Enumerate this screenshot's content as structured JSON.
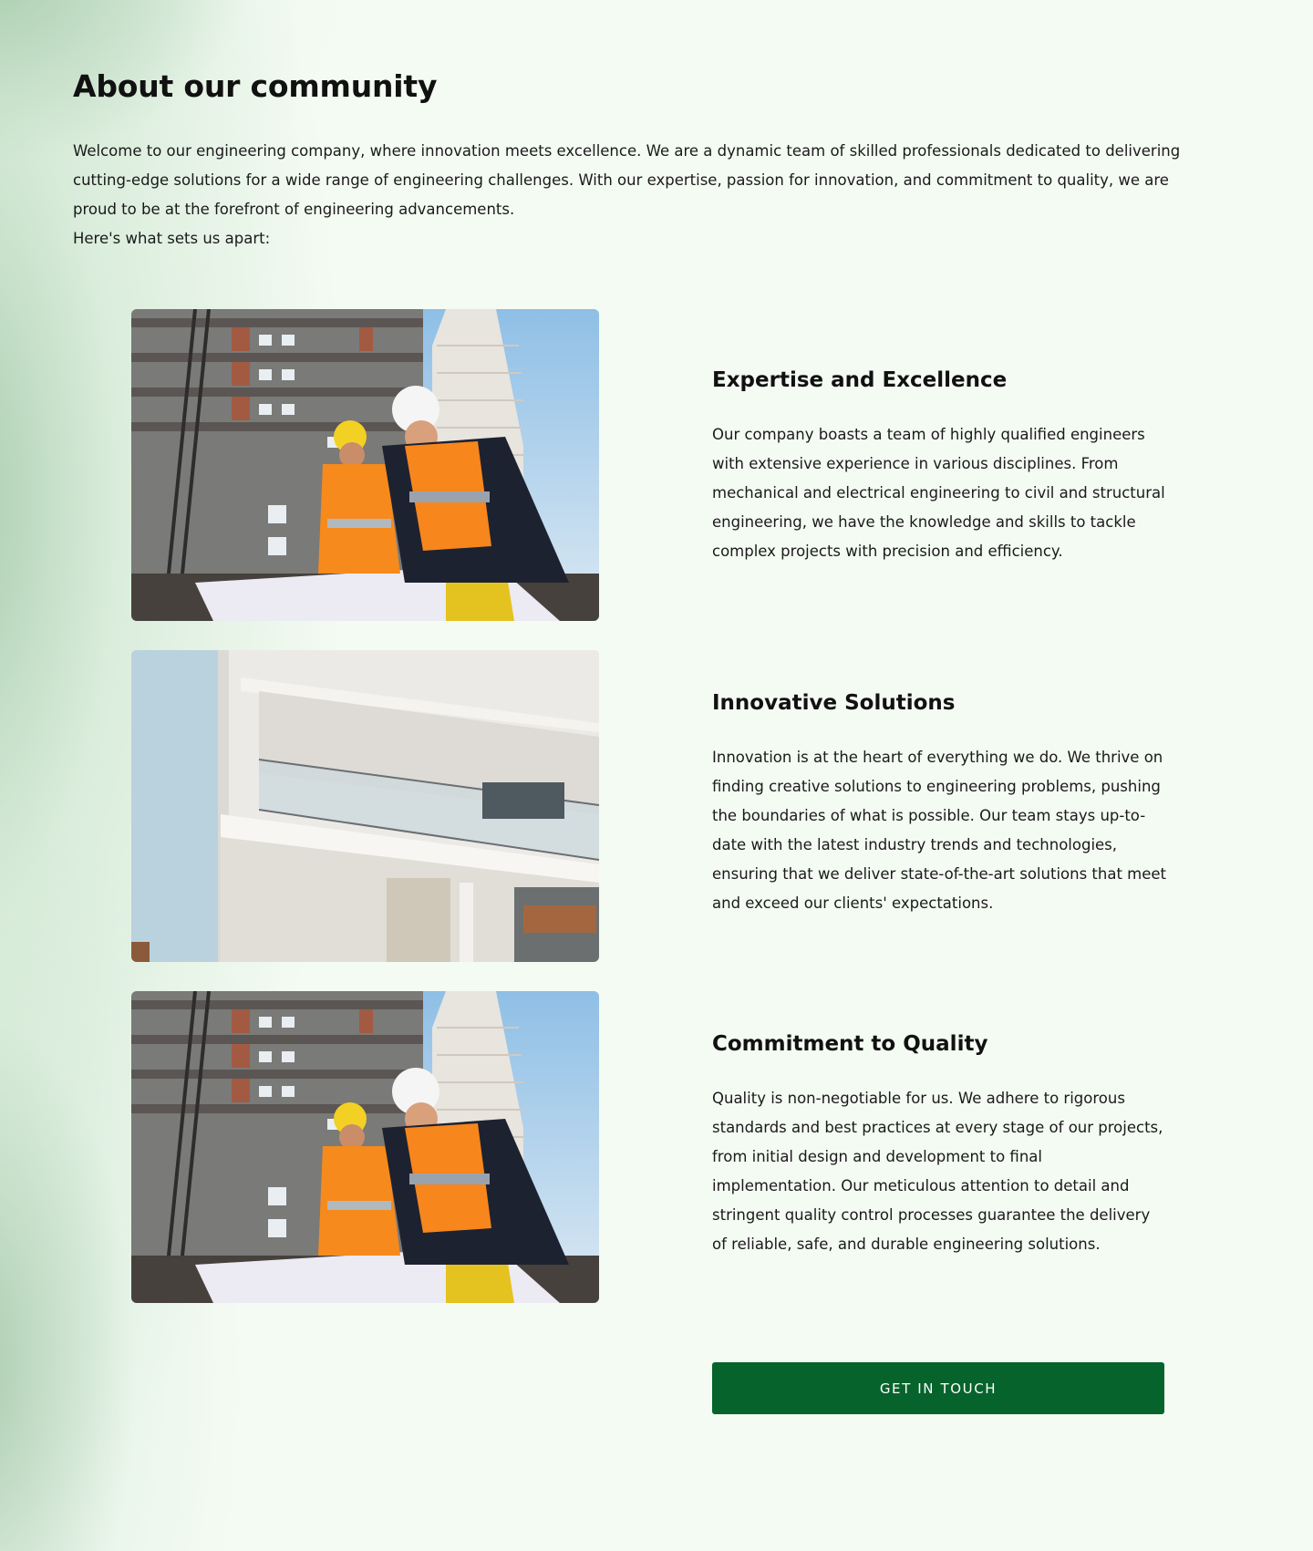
{
  "page": {
    "title": "About our community",
    "intro_lines": [
      "Welcome to our engineering company, where innovation meets excellence. We are a dynamic team of skilled professionals dedicated to delivering cutting-edge solutions for a wide range of engineering challenges. With our expertise, passion for innovation, and commitment to quality, we are proud to be at the forefront of engineering advancements.",
      "Here's what sets us apart:"
    ]
  },
  "features": [
    {
      "heading": "Expertise and Excellence",
      "body": "Our company boasts a team of highly qualified engineers with extensive experience in various disciplines. From mechanical and electrical engineering to civil and structural engineering, we have the knowledge and skills to tackle complex projects with precision and efficiency.",
      "image": "engineers-reviewing-blueprints"
    },
    {
      "heading": "Innovative Solutions",
      "body": "Innovation is at the heart of everything we do. We thrive on finding creative solutions to engineering problems, pushing the boundaries of what is possible. Our team stays up-to-date with the latest industry trends and technologies, ensuring that we deliver state-of-the-art solutions that meet and exceed our clients' expectations.",
      "image": "modern-building-balcony"
    },
    {
      "heading": "Commitment to Quality",
      "body": "Quality is non-negotiable for us. We adhere to rigorous standards and best practices at every stage of our projects, from initial design and development to final implementation. Our meticulous attention to detail and stringent quality control processes guarantee the delivery of reliable, safe, and durable engineering solutions.",
      "image": "engineers-reviewing-blueprints"
    }
  ],
  "cta": {
    "label": "GET IN TOUCH"
  },
  "colors": {
    "accent": "#05632b",
    "background": "#f4fbf3",
    "text": "#111111"
  }
}
